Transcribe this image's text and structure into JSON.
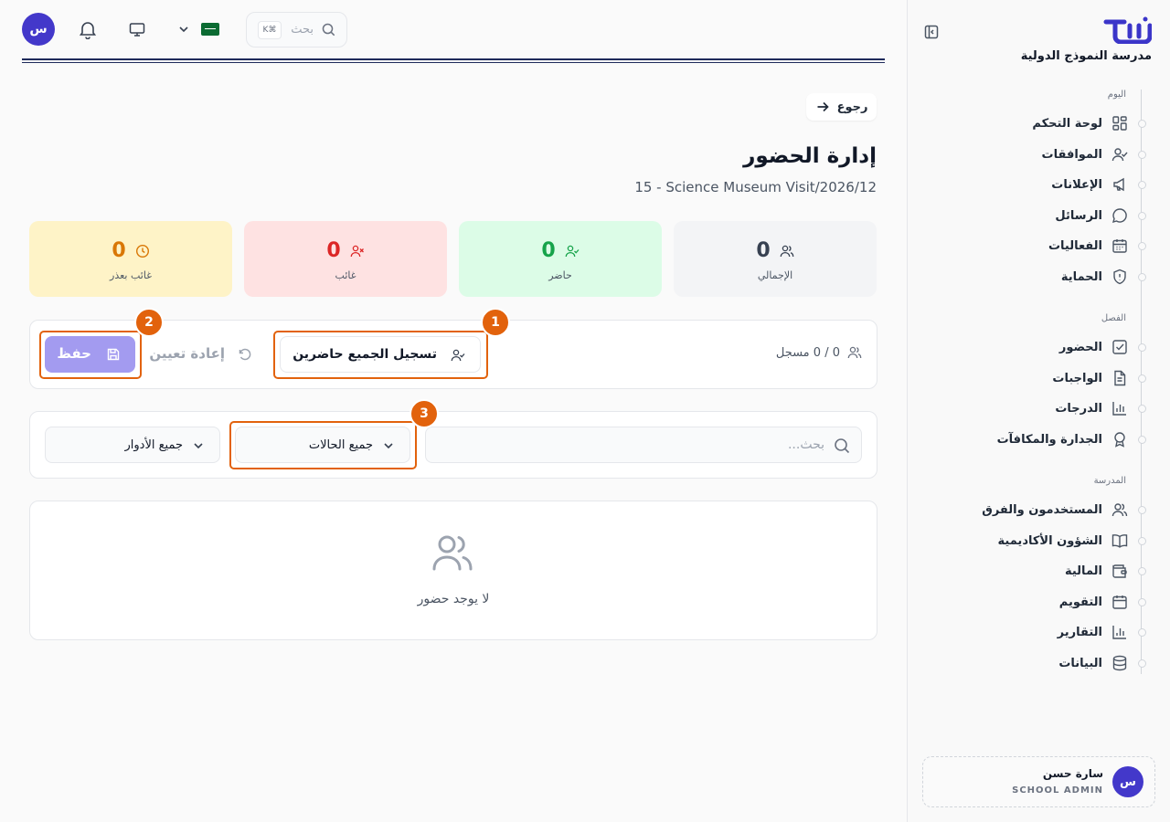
{
  "sidebar": {
    "school_name": "مدرسة النموذج الدولية",
    "sections": {
      "today": "اليوم",
      "class": "الفصل",
      "school": "المدرسة"
    },
    "items": [
      {
        "label": "لوحة التحكم",
        "icon": "dashboard-icon"
      },
      {
        "label": "الموافقات",
        "icon": "user-check-icon"
      },
      {
        "label": "الإعلانات",
        "icon": "megaphone-icon"
      },
      {
        "label": "الرسائل",
        "icon": "message-icon"
      },
      {
        "label": "الفعاليات",
        "icon": "calendar-grid-icon"
      },
      {
        "label": "الحماية",
        "icon": "shield-icon"
      },
      {
        "label": "الحضور",
        "icon": "check-square-icon"
      },
      {
        "label": "الواجبات",
        "icon": "document-icon"
      },
      {
        "label": "الدرجات",
        "icon": "bar-chart-icon"
      },
      {
        "label": "الجدارة والمكافآت",
        "icon": "award-icon"
      },
      {
        "label": "المستخدمون والفرق",
        "icon": "users-icon"
      },
      {
        "label": "الشؤون الأكاديمية",
        "icon": "book-icon"
      },
      {
        "label": "المالية",
        "icon": "wallet-icon"
      },
      {
        "label": "التقويم",
        "icon": "calendar-icon"
      },
      {
        "label": "التقارير",
        "icon": "chart-icon"
      },
      {
        "label": "البيانات",
        "icon": "database-icon"
      }
    ],
    "user": {
      "initial": "س",
      "name": "سارة حسن",
      "role": "SCHOOL ADMIN"
    }
  },
  "topbar": {
    "avatar_initial": "س",
    "search_placeholder": "بحث",
    "search_shortcut": "K⌘"
  },
  "page": {
    "back_label": "رجوع",
    "title": "إدارة الحضور",
    "subtitle": "15 - Science Museum Visit/2026/12"
  },
  "stats": [
    {
      "value": "0",
      "label": "الإجمالي",
      "color": "#374151",
      "bg": "#f3f4f6",
      "icon": "users-icon"
    },
    {
      "value": "0",
      "label": "حاضر",
      "color": "#16a34a",
      "bg": "#dcfce7",
      "icon": "user-check-icon"
    },
    {
      "value": "0",
      "label": "غائب",
      "color": "#dc2626",
      "bg": "#fee2e2",
      "icon": "user-x-icon"
    },
    {
      "value": "0",
      "label": "غائب بعذر",
      "color": "#d97706",
      "bg": "#fef3c7",
      "icon": "clock-icon"
    }
  ],
  "actions": {
    "registered_count": "0 / 0 مسجل",
    "mark_all_present": "تسجيل الجميع حاضرين",
    "reset": "إعادة تعيين",
    "save": "حفظ"
  },
  "filters": {
    "search_placeholder": "بحث...",
    "status_value": "جميع الحالات",
    "role_value": "جميع الأدوار"
  },
  "empty_state": "لا يوجد حضور",
  "callouts": [
    "1",
    "2",
    "3"
  ],
  "accent_color": "#e2620c",
  "brand_color": "#4338ca"
}
